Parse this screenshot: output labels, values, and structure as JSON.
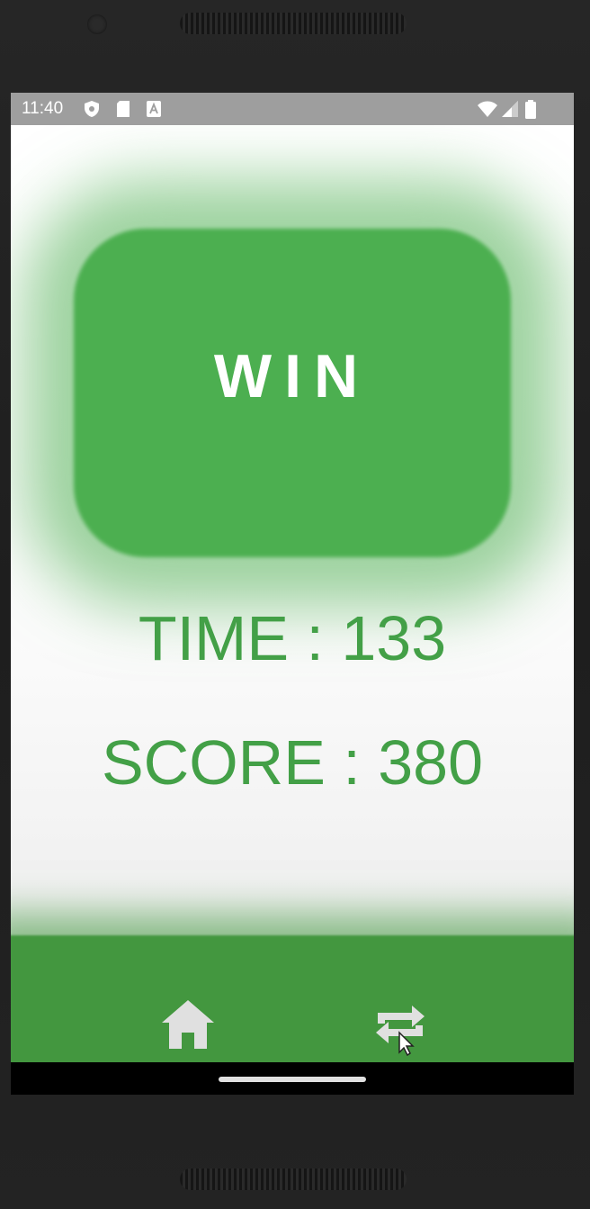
{
  "status_bar": {
    "time": "11:40",
    "left_icons": [
      "shield-icon",
      "sd-card-icon",
      "notification-a-icon"
    ],
    "right_icons": [
      "wifi-icon",
      "signal-icon",
      "battery-icon"
    ]
  },
  "result": {
    "title": "WIN",
    "time_text": "TIME :  133",
    "score_text": "SCORE : 380"
  },
  "bottom_nav": {
    "home_icon": "home-icon",
    "replay_icon": "repeat-icon"
  },
  "colors": {
    "accent_green": "#4caf50",
    "text_green": "#43a047",
    "status_bar": "#9e9e9e"
  }
}
